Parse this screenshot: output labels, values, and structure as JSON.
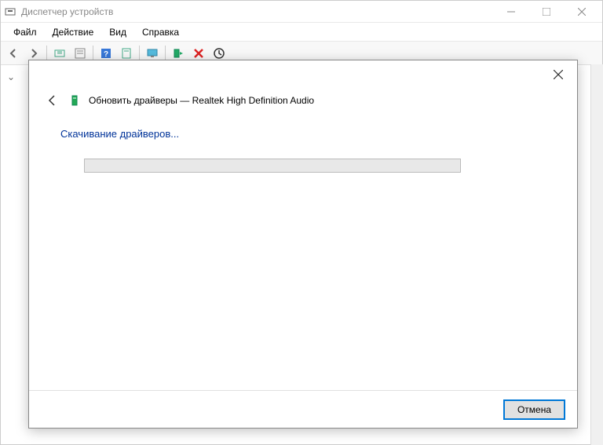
{
  "main_window": {
    "title": "Диспетчер устройств"
  },
  "menubar": {
    "file": "Файл",
    "action": "Действие",
    "view": "Вид",
    "help": "Справка"
  },
  "dialog": {
    "title": "Обновить драйверы — Realtek High Definition Audio",
    "status": "Скачивание драйверов...",
    "cancel": "Отмена"
  }
}
